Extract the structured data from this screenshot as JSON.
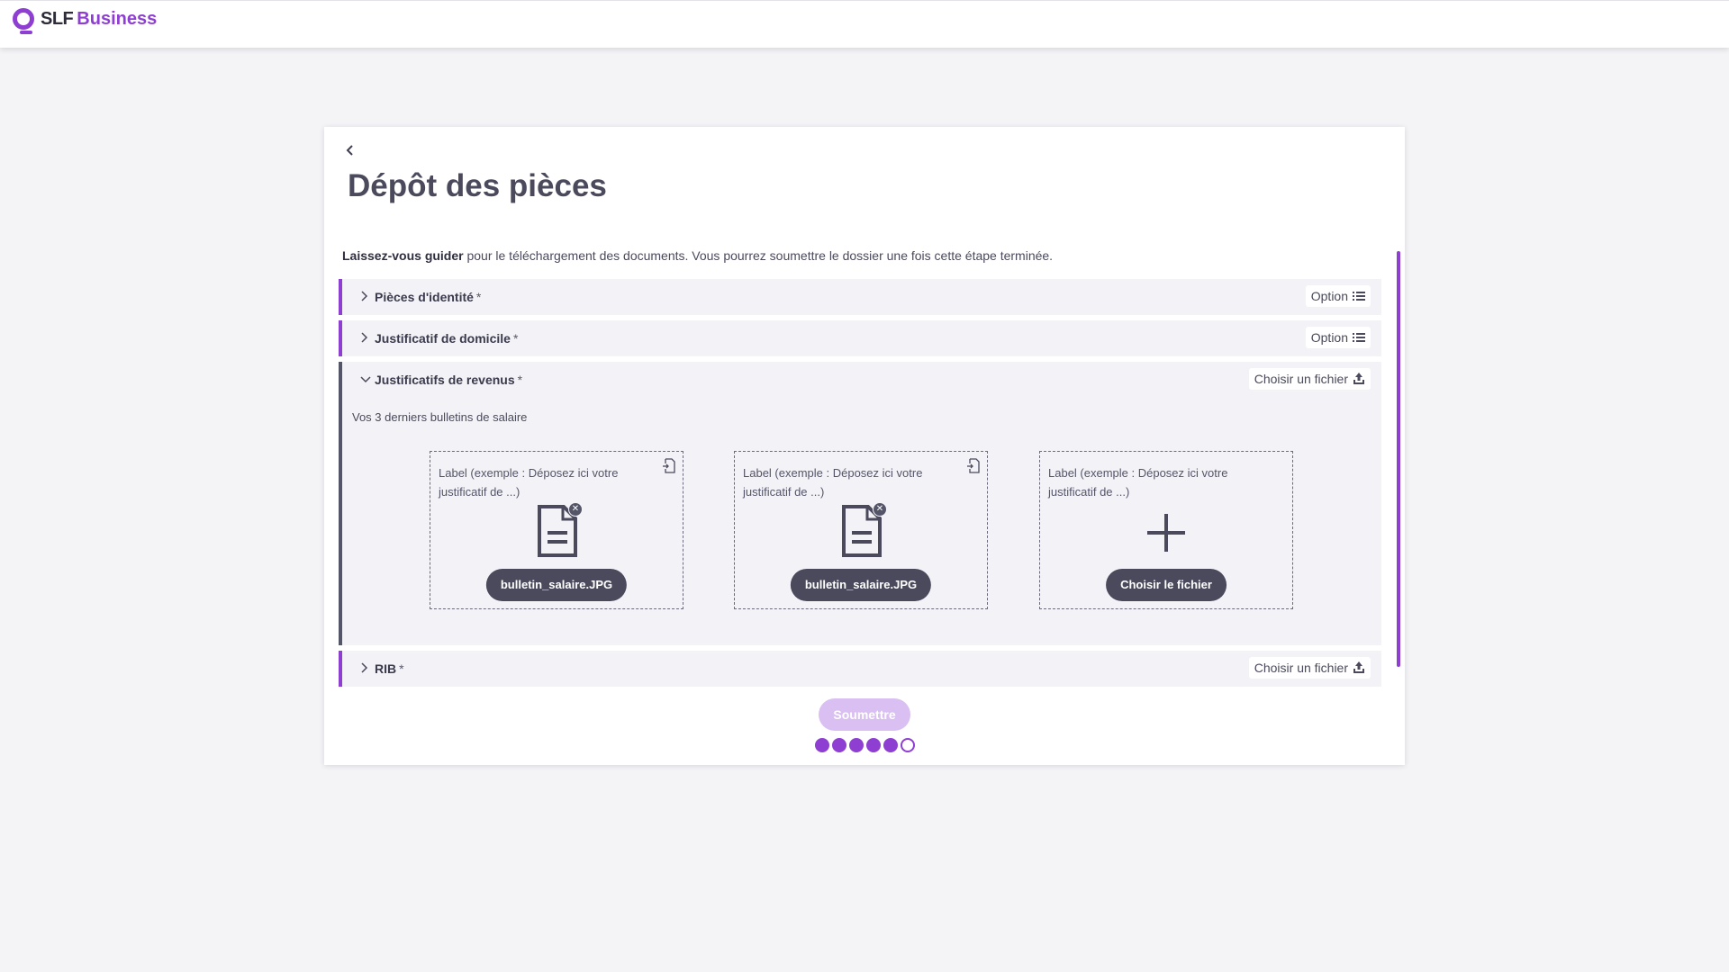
{
  "header": {
    "brand_slf": "SLF",
    "brand_business": "Business"
  },
  "page": {
    "title": "Dépôt des pièces",
    "intro_bold": "Laissez-vous guider",
    "intro_text": " pour le téléchargement des documents. Vous pourrez soumettre le dossier une fois cette étape terminée."
  },
  "sections": [
    {
      "title": "Pièces d'identité",
      "required": "*",
      "action": "Option",
      "action_icon": "list-icon",
      "expanded": false
    },
    {
      "title": "Justificatif de domicile",
      "required": "*",
      "action": "Option",
      "action_icon": "list-icon",
      "expanded": false
    },
    {
      "title": "Justificatifs de revenus",
      "required": "*",
      "action": "Choisir un fichier",
      "action_icon": "upload-icon",
      "expanded": true,
      "description": "Vos 3 derniers bulletins de salaire",
      "dropzones": [
        {
          "label": "Label (exemple : Déposez ici votre justificatif de ...)",
          "file": "bulletin_salaire.JPG",
          "state": "filled"
        },
        {
          "label": "Label (exemple : Déposez ici votre justificatif de ...)",
          "file": "bulletin_salaire.JPG",
          "state": "filled"
        },
        {
          "label": "Label (exemple : Déposez ici votre justificatif de ...)",
          "button": "Choisir le fichier",
          "state": "empty"
        }
      ]
    },
    {
      "title": "RIB",
      "required": "*",
      "action": "Choisir un fichier",
      "action_icon": "upload-icon",
      "expanded": false
    }
  ],
  "submit_label": "Soumettre",
  "progress": {
    "completed_steps": 5,
    "total_steps": 6
  },
  "colors": {
    "accent": "#8e3fd2",
    "dark": "#4a4a5c",
    "submit_disabled": "#d9bff2",
    "panel": "#f3f3f7"
  }
}
